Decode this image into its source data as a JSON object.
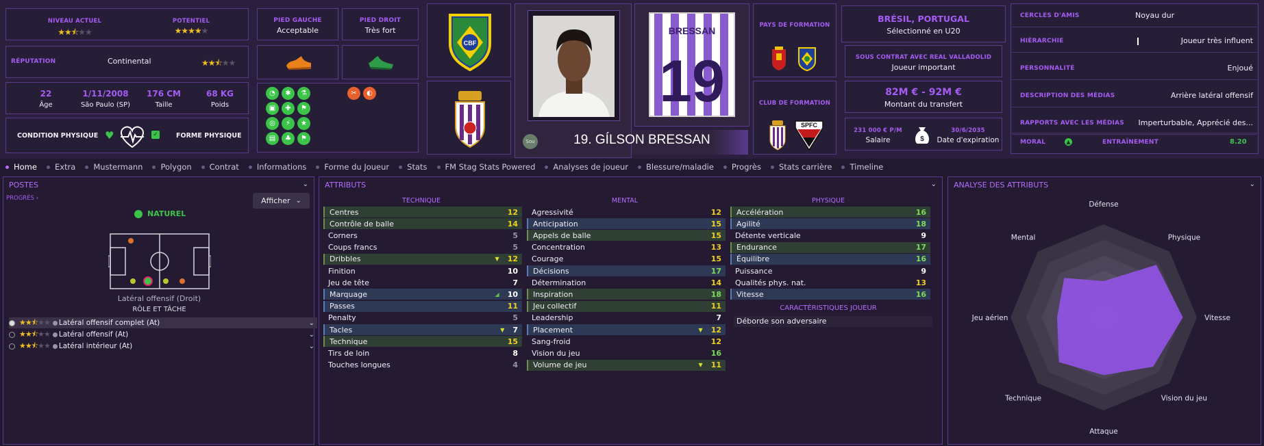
{
  "header": {
    "current_level_label": "NIVEAU ACTUEL",
    "potential_label": "POTENTIEL",
    "current_level_stars": 2.5,
    "potential_stars": 4,
    "reputation_label": "RÉPUTATION",
    "reputation_value": "Continental",
    "reputation_stars": 2.5,
    "age": "22",
    "age_label": "Âge",
    "birth_date": "1/11/2008",
    "birth_place": "São Paulo (SP)",
    "height": "176 CM",
    "height_label": "Taille",
    "weight": "68 KG",
    "weight_label": "Poids",
    "condition_label": "CONDITION PHYSIQUE",
    "form_label": "FORME PHYSIQUE",
    "left_foot_label": "PIED GAUCHE",
    "left_foot_value": "Acceptable",
    "right_foot_label": "PIED DROIT",
    "right_foot_value": "Très fort",
    "crest_national_text": "CBF",
    "shirt_name": "BRESSAN",
    "shirt_number": "19",
    "player_name": "19. GÍLSON BRESSAN",
    "status_badge": "Sou",
    "training_country_label": "PAYS DE FORMATION",
    "training_club_label": "CLUB DE FORMATION",
    "training_club_badge": "SPFC",
    "nationality": "BRÉSIL, PORTUGAL",
    "international": "Sélectionné en U20",
    "contract_label": "SOUS CONTRAT AVEC REAL VALLADOLID",
    "contract_role": "Joueur important",
    "transfer_value": "82M € - 92M €",
    "transfer_label": "Montant du transfert",
    "salary": "231 000 € P/M",
    "salary_label": "Salaire",
    "expiry": "30/6/2035",
    "expiry_label": "Date d'expiration",
    "social": [
      {
        "label": "CERCLES D'AMIS",
        "value": "Noyau dur"
      },
      {
        "label": "HIÉRARCHIE",
        "value": "Joueur très influent"
      },
      {
        "label": "PERSONNALITÉ",
        "value": "Enjoué"
      },
      {
        "label": "DESCRIPTION DES MÉDIAS",
        "value": "Arrière latéral offensif"
      },
      {
        "label": "RAPPORTS AVEC LES MÉDIAS",
        "value": "Imperturbable, Apprécié des..."
      }
    ],
    "morale_label": "MORAL",
    "training_label": "ENTRAÎNEMENT",
    "training_value": "8.20",
    "colors": {
      "accent": "#a55cf2",
      "green": "#3cc44a"
    }
  },
  "tabs": [
    "Home",
    "Extra",
    "Mustermann",
    "Polygon",
    "Contrat",
    "Informations",
    "Forme du Joueur",
    "Stats",
    "FM Stag Stats Powered",
    "Analyses de joueur",
    "Blessure/maladie",
    "Progrès",
    "Stats carrière",
    "Timeline"
  ],
  "positions": {
    "title": "POSTES",
    "progress_link": "PROGRÈS",
    "show_button": "Afficher",
    "natural_label": "NATUREL",
    "position_name": "Latéral offensif (Droit)",
    "role_header": "RÔLE ET TÂCHE",
    "roles": [
      {
        "name": "Latéral offensif complet (At)",
        "stars": 2.5,
        "selected": true
      },
      {
        "name": "Latéral offensif (At)",
        "stars": 2.5,
        "selected": false
      },
      {
        "name": "Latéral intérieur (At)",
        "stars": 2.5,
        "selected": false
      }
    ]
  },
  "attributes": {
    "title": "ATTRIBUTS",
    "technique_header": "TECHNIQUE",
    "mental_header": "MENTAL",
    "physical_header": "PHYSIQUE",
    "traits_header": "CARACTÉRISTIQUES JOUEUR",
    "traits": [
      "Déborde son adversaire"
    ],
    "technique": [
      {
        "name": "Centres",
        "value": "12",
        "hl": "g"
      },
      {
        "name": "Contrôle de balle",
        "value": "14",
        "hl": "g"
      },
      {
        "name": "Corners",
        "value": "5",
        "hl": ""
      },
      {
        "name": "Coups francs",
        "value": "5",
        "hl": ""
      },
      {
        "name": "Dribbles",
        "value": "12",
        "hl": "g",
        "arrow": "down"
      },
      {
        "name": "Finition",
        "value": "10",
        "hl": ""
      },
      {
        "name": "Jeu de tête",
        "value": "7",
        "hl": ""
      },
      {
        "name": "Marquage",
        "value": "10",
        "hl": "b",
        "arrow": "up"
      },
      {
        "name": "Passes",
        "value": "11",
        "hl": "b"
      },
      {
        "name": "Penalty",
        "value": "5",
        "hl": ""
      },
      {
        "name": "Tacles",
        "value": "7",
        "hl": "b",
        "arrow": "down"
      },
      {
        "name": "Technique",
        "value": "15",
        "hl": "g"
      },
      {
        "name": "Tirs de loin",
        "value": "8",
        "hl": ""
      },
      {
        "name": "Touches longues",
        "value": "4",
        "hl": ""
      }
    ],
    "mental": [
      {
        "name": "Agressivité",
        "value": "12",
        "hl": ""
      },
      {
        "name": "Anticipation",
        "value": "15",
        "hl": "b"
      },
      {
        "name": "Appels de balle",
        "value": "15",
        "hl": "g"
      },
      {
        "name": "Concentration",
        "value": "13",
        "hl": ""
      },
      {
        "name": "Courage",
        "value": "15",
        "hl": ""
      },
      {
        "name": "Décisions",
        "value": "17",
        "hl": "b"
      },
      {
        "name": "Détermination",
        "value": "14",
        "hl": ""
      },
      {
        "name": "Inspiration",
        "value": "18",
        "hl": "g"
      },
      {
        "name": "Jeu collectif",
        "value": "11",
        "hl": "g"
      },
      {
        "name": "Leadership",
        "value": "7",
        "hl": ""
      },
      {
        "name": "Placement",
        "value": "12",
        "hl": "b",
        "arrow": "down"
      },
      {
        "name": "Sang-froid",
        "value": "12",
        "hl": ""
      },
      {
        "name": "Vision du jeu",
        "value": "16",
        "hl": ""
      },
      {
        "name": "Volume de jeu",
        "value": "11",
        "hl": "g",
        "arrow": "down"
      }
    ],
    "physical": [
      {
        "name": "Accélération",
        "value": "16",
        "hl": "g"
      },
      {
        "name": "Agilité",
        "value": "18",
        "hl": "b"
      },
      {
        "name": "Détente verticale",
        "value": "9",
        "hl": ""
      },
      {
        "name": "Endurance",
        "value": "17",
        "hl": "g"
      },
      {
        "name": "Équilibre",
        "value": "16",
        "hl": "b"
      },
      {
        "name": "Puissance",
        "value": "9",
        "hl": ""
      },
      {
        "name": "Qualités phys. nat.",
        "value": "13",
        "hl": ""
      },
      {
        "name": "Vitesse",
        "value": "16",
        "hl": "b"
      }
    ]
  },
  "analysis": {
    "title": "ANALYSE DES ATTRIBUTS",
    "axes": [
      "Défense",
      "Physique",
      "Vitesse",
      "Vision du jeu",
      "Attaque",
      "Technique",
      "Jeu aérien",
      "Mental"
    ],
    "values": [
      0.39,
      0.8,
      0.85,
      0.75,
      0.62,
      0.68,
      0.5,
      0.6
    ]
  }
}
